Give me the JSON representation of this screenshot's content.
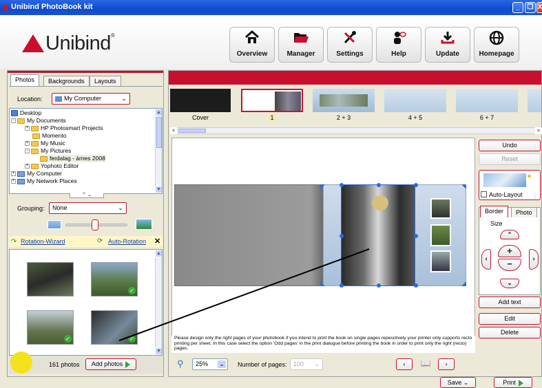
{
  "window": {
    "title": "Unibind PhotoBook kit",
    "buttons": [
      "_",
      "❐",
      "X"
    ]
  },
  "brand": {
    "name": "Unibind",
    "mark": "®"
  },
  "nav": [
    {
      "label": "Overview",
      "icon": "home-icon",
      "glyph": "⌂"
    },
    {
      "label": "Manager",
      "icon": "folder-icon",
      "glyph": "▰"
    },
    {
      "label": "Settings",
      "icon": "tools-icon",
      "glyph": "✂"
    },
    {
      "label": "Help",
      "icon": "help-icon",
      "glyph": "?"
    },
    {
      "label": "Update",
      "icon": "download-icon",
      "glyph": "⤓"
    },
    {
      "label": "Homepage",
      "icon": "globe-icon",
      "glyph": "⊕"
    }
  ],
  "left": {
    "tabs": [
      "Photos",
      "Backgrounds",
      "Layouts"
    ],
    "location_label": "Location:",
    "location_value": "My Computer",
    "tree": [
      {
        "label": "Desktop",
        "indent": 0,
        "pm": ""
      },
      {
        "label": "My Documents",
        "indent": 1,
        "pm": "-"
      },
      {
        "label": "HP Photosmart Projects",
        "indent": 2,
        "pm": "+"
      },
      {
        "label": "Momento",
        "indent": 2,
        "pm": ""
      },
      {
        "label": "My Music",
        "indent": 2,
        "pm": "+"
      },
      {
        "label": "My Pictures",
        "indent": 2,
        "pm": "-"
      },
      {
        "label": "ferdalag - árnes 2008",
        "indent": 3,
        "pm": ""
      },
      {
        "label": "Yophoto Editor",
        "indent": 2,
        "pm": "+"
      },
      {
        "label": "My Computer",
        "indent": 1,
        "pm": "+"
      },
      {
        "label": "My Network Places",
        "indent": 1,
        "pm": "+"
      }
    ],
    "grouping_label": "Grouping:",
    "grouping_value": "None",
    "rotation_wizard": "Rotation-Wizard",
    "auto_rotation": "Auto-Rotation",
    "photo_count": "161 photos",
    "add_photos": "Add photos"
  },
  "strip": {
    "labels": [
      "Cover",
      "1",
      "2 + 3",
      "4 + 5",
      "6 + 7"
    ]
  },
  "editor": {
    "note": "Please design only the right pages of your photobook if you intend to print the book on single pages repesctively your printer only supports recto printing per sheet. In this case select the option 'Odd pages' in the print dialogue before printing the book in order to print only the right (recto) pages.",
    "zoom": "25%",
    "pages_label": "Number of pages:",
    "pages_value": "100"
  },
  "side": {
    "undo": "Undo",
    "reset": "Reset",
    "auto_layout": "Auto-Layout",
    "tabs": [
      "Border",
      "Photo"
    ],
    "size_label": "Size",
    "add_text": "Add text",
    "edit": "Edit",
    "delete": "Delete"
  },
  "bottom": {
    "save": "Save",
    "print": "Print"
  },
  "colors": {
    "accent": "#c8102e",
    "titlebar": "#0c4bd1"
  }
}
